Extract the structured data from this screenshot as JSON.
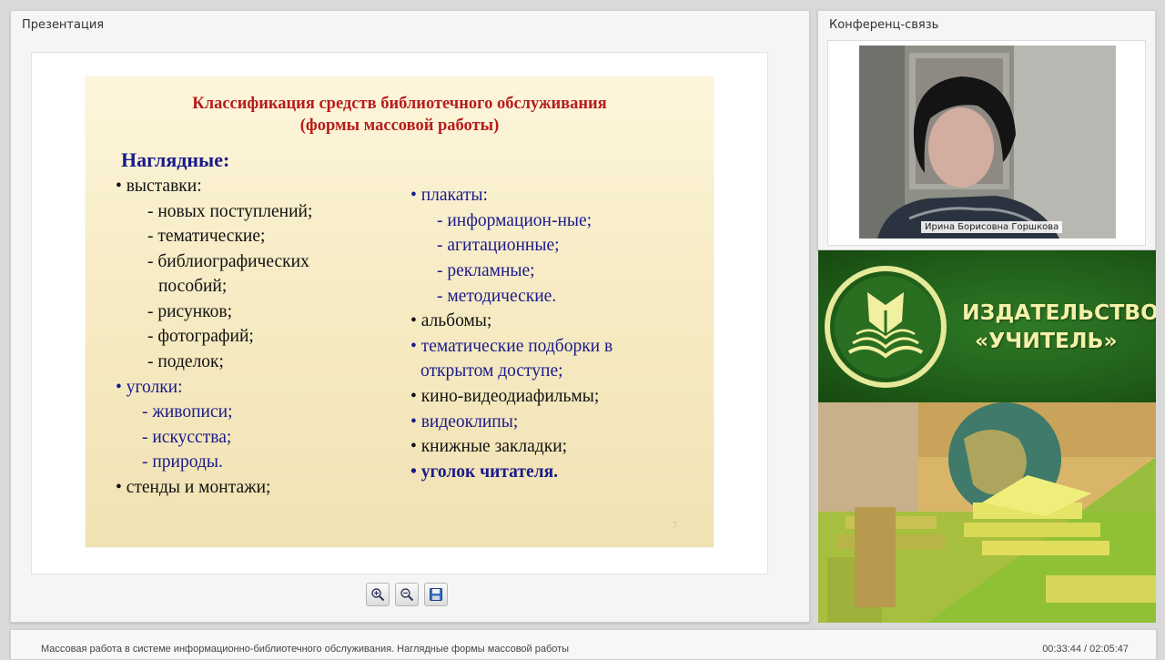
{
  "presentation": {
    "panel_title": "Презентация",
    "slide": {
      "title_line1": "Классификация средств библиотечного обслуживания",
      "title_line2": "(формы массовой работы)",
      "heading": "Наглядные:",
      "left_column": [
        "• выставки:",
        "- новых  поступлений;",
        "- тематические;",
        "-  библиографических",
        "пособий;",
        "- рисунков;",
        "- фотографий;",
        "- поделок;",
        "• уголки:",
        "- живописи;",
        "- искусства;",
        "- природы.",
        "• стенды и монтажи;"
      ],
      "right_column": [
        "• плакаты:",
        "- информацион-ные;",
        "- агитационные;",
        "- рекламные;",
        "- методические.",
        "• альбомы;",
        "• тематические подборки в",
        "открытом доступе;",
        "• кино-видеодиафильмы;",
        "• видеоклипы;",
        "• книжные закладки;",
        "•  уголок читателя."
      ],
      "page_number": "7"
    },
    "toolbar": {
      "zoom_in_icon": "zoom-in-icon",
      "zoom_out_icon": "zoom-out-icon",
      "save_icon": "save-icon"
    }
  },
  "conference": {
    "panel_title": "Конференц-связь",
    "speaker_name": "Ирина Борисовна Горшкова"
  },
  "banner": {
    "line1": "ИЗДАТЕЛЬСТВО",
    "line2": "«УЧИТЕЛЬ»",
    "logo_icon": "book-emblem-icon"
  },
  "status": {
    "lecture_title": "Массовая работа в системе информационно-библиотечного обслуживания. Наглядные формы массовой работы",
    "time": "00:33:44 / 02:05:47"
  },
  "colors": {
    "title_red": "#b71c1c",
    "text_blue": "#1a1a8c",
    "brand_green": "#1e5a17",
    "brand_yellow": "#f4f1a8"
  }
}
